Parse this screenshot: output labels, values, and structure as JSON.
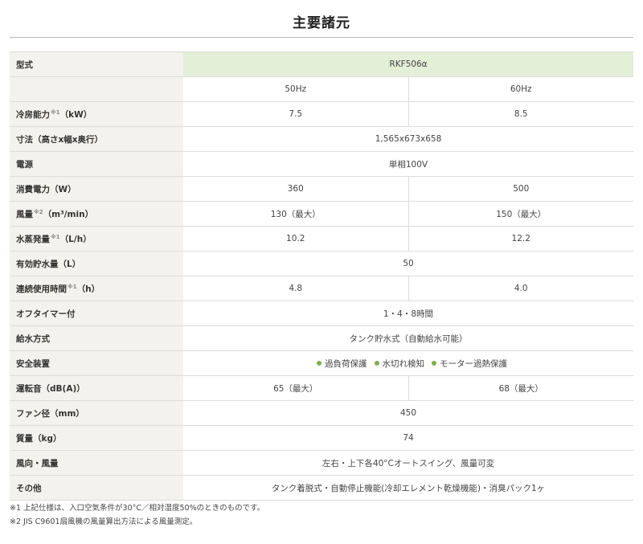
{
  "title": "主要諸元",
  "model_row": {
    "label": "型式",
    "model": "RKF506α"
  },
  "freq_row": {
    "hz50": "50Hz",
    "hz60": "60Hz"
  },
  "rows": [
    {
      "label": "冷房能力",
      "sup": "※1",
      "unit": "（kW）",
      "v50": "7.5",
      "v60": "8.5"
    },
    {
      "label": "寸法（高さx幅x奥行）",
      "value": "1,565x673x658"
    },
    {
      "label": "電源",
      "value": "単相100V"
    },
    {
      "label": "消費電力（W）",
      "v50": "360",
      "v60": "500"
    },
    {
      "label": "風量",
      "sup": "※2",
      "unit": "（m³/min）",
      "v50": "130（最大）",
      "v60": "150（最大）"
    },
    {
      "label": "水蒸発量",
      "sup": "※1",
      "unit": "（L/h）",
      "v50": "10.2",
      "v60": "12.2"
    },
    {
      "label": "有効貯水量（L）",
      "value": "50"
    },
    {
      "label": "連続使用時間",
      "sup": "※1",
      "unit": "（h）",
      "v50": "4.8",
      "v60": "4.0"
    },
    {
      "label": "オフタイマー付",
      "value": "1・4・8時間"
    },
    {
      "label": "給水方式",
      "value": "タンク貯水式（自動給水可能）"
    },
    {
      "label": "安全装置",
      "items": [
        "過負荷保護",
        "水切れ検知",
        "モーター過熱保護"
      ]
    },
    {
      "label": "運転音（dB(A)）",
      "v50": "65（最大）",
      "v60": "68（最大）"
    },
    {
      "label": "ファン径（mm）",
      "value": "450"
    },
    {
      "label": "質量（kg）",
      "value": "74"
    },
    {
      "label": "風向・風量",
      "value": "左右・上下各40°Cオートスイング、風量可変"
    },
    {
      "label": "その他",
      "value": "タンク着脱式・自動停止機能(冷却エレメント乾燥機能)・消臭パック1ヶ"
    }
  ],
  "notes": [
    "※1 上記仕様は、入口空気条件が30°C／相対湿度50%のときのものです。",
    "※2 JIS C9601扇風機の風量算出方法による風量測定。"
  ],
  "colors": {
    "label_bg": "#f3f2ee",
    "model_bg": "#e3efd7",
    "bullet": "#7fb04a"
  }
}
